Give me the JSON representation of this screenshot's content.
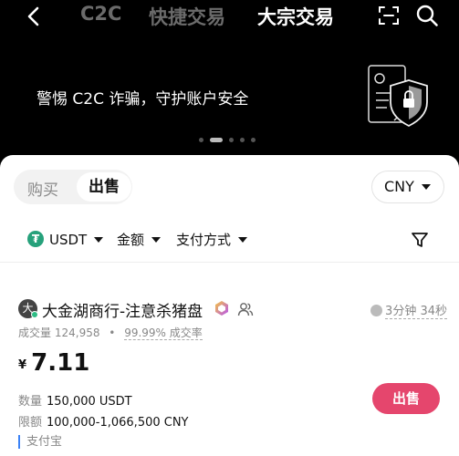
{
  "nav": {
    "tabs": [
      "C2C",
      "快捷交易",
      "大宗交易"
    ],
    "active_tab": "大宗交易"
  },
  "banner": {
    "text": "警惕 C2C 诈骗，守护账户安全",
    "dots_count": 5,
    "active_dot": 1
  },
  "trade": {
    "buy_label": "购买",
    "sell_label": "出售",
    "currency": "CNY"
  },
  "filters": {
    "coin": "USDT",
    "amount_label": "金额",
    "payment_label": "支付方式"
  },
  "listing": {
    "avatar_char": "大",
    "merchant_name": "大金湖商行-注意杀猪盘",
    "response_time": "3分钟 34秒",
    "volume_label": "成交量",
    "volume": "124,958",
    "completion_rate": "99.99%",
    "completion_label": "成交率",
    "currency_symbol": "¥",
    "price": "7.11",
    "quantity_label": "数量",
    "quantity": "150,000 USDT",
    "limit_label": "限额",
    "limit": "100,000-1,066,500 CNY",
    "action_label": "出售",
    "payment_method": "支付宝"
  },
  "colors": {
    "accent_sell": "#e5466d",
    "tether": "#26a17b",
    "online": "#2ebd85",
    "payment_bar": "#3b82f6"
  },
  "icons": [
    "back-arrow-icon",
    "scan-icon",
    "search-icon",
    "security-shield-icon",
    "tether-icon",
    "filter-icon",
    "verified-badge-icon",
    "people-icon",
    "clock-icon"
  ]
}
